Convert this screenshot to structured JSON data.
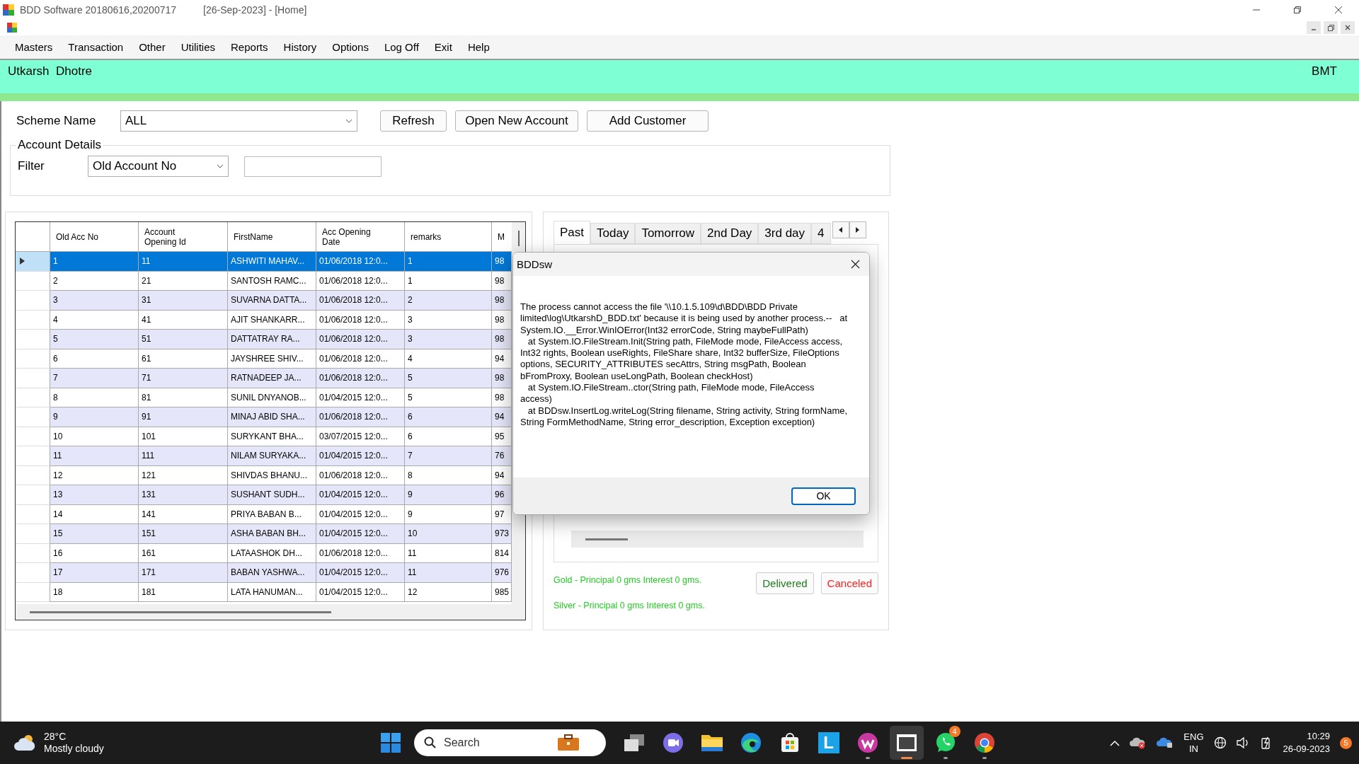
{
  "window": {
    "title": "BDD Software 20180616,20200717",
    "subtitle": "[26-Sep-2023] - [Home]"
  },
  "menu": [
    "Masters",
    "Transaction",
    "Other",
    "Utilities",
    "Reports",
    "History",
    "Options",
    "Log Off",
    "Exit",
    "Help"
  ],
  "header": {
    "user": "Utkarsh  Dhotre",
    "branch": "BMT"
  },
  "scheme": {
    "label": "Scheme Name",
    "value": "ALL"
  },
  "buttons": [
    "Refresh",
    "Open New Account",
    "Add Customer"
  ],
  "account_details": {
    "legend": "Account Details",
    "filter_label": "Filter",
    "filter_value": "Old Account No"
  },
  "table": {
    "columns": [
      "Old Acc No",
      "Account Opening Id",
      "FirstName",
      "Acc Opening Date",
      "remarks",
      "M"
    ],
    "rows": [
      {
        "selected": true,
        "cells": [
          "1",
          "11",
          "ASHWITI MAHAV...",
          "01/06/2018 12:0...",
          "1",
          "98"
        ]
      },
      {
        "selected": false,
        "cells": [
          "2",
          "21",
          "SANTOSH RAMC...",
          "01/06/2018 12:0...",
          "1",
          "98"
        ]
      },
      {
        "selected": false,
        "cells": [
          "3",
          "31",
          "SUVARNA DATTA...",
          "01/06/2018 12:0...",
          "2",
          "98"
        ]
      },
      {
        "selected": false,
        "cells": [
          "4",
          "41",
          "AJIT SHANKARR...",
          "01/06/2018 12:0...",
          "3",
          "98"
        ]
      },
      {
        "selected": false,
        "cells": [
          "5",
          "51",
          "DATTATRAY RA...",
          "01/06/2018 12:0...",
          "3",
          "98"
        ]
      },
      {
        "selected": false,
        "cells": [
          "6",
          "61",
          "JAYSHREE SHIV...",
          "01/06/2018 12:0...",
          "4",
          "94"
        ]
      },
      {
        "selected": false,
        "cells": [
          "7",
          "71",
          "RATNADEEP JA...",
          "01/06/2018 12:0...",
          "5",
          "98"
        ]
      },
      {
        "selected": false,
        "cells": [
          "8",
          "81",
          "SUNIL DNYANOB...",
          "01/04/2015 12:0...",
          "5",
          "98"
        ]
      },
      {
        "selected": false,
        "cells": [
          "9",
          "91",
          "MINAJ ABID SHA...",
          "01/06/2018 12:0...",
          "6",
          "94"
        ]
      },
      {
        "selected": false,
        "cells": [
          "10",
          "101",
          "SURYKANT BHA...",
          "03/07/2015 12:0...",
          "6",
          "95"
        ]
      },
      {
        "selected": false,
        "cells": [
          "11",
          "111",
          "NILAM SURYAKA...",
          "01/04/2015 12:0...",
          "7",
          "76"
        ]
      },
      {
        "selected": false,
        "cells": [
          "12",
          "121",
          "SHIVDAS BHANU...",
          "01/06/2018 12:0...",
          "8",
          "94"
        ]
      },
      {
        "selected": false,
        "cells": [
          "13",
          "131",
          "SUSHANT SUDH...",
          "01/04/2015 12:0...",
          "9",
          "96"
        ]
      },
      {
        "selected": false,
        "cells": [
          "14",
          "141",
          "PRIYA BABAN B...",
          "01/04/2015 12:0...",
          "9",
          "97"
        ]
      },
      {
        "selected": false,
        "cells": [
          "15",
          "151",
          "ASHA BABAN BH...",
          "01/04/2015 12:0...",
          "10",
          "973"
        ]
      },
      {
        "selected": false,
        "cells": [
          "16",
          "161",
          "LATAASHOK DH...",
          "01/06/2018 12:0...",
          "11",
          "814"
        ]
      },
      {
        "selected": false,
        "cells": [
          "17",
          "171",
          "BABAN YASHWA...",
          "01/04/2015 12:0...",
          "11",
          "976"
        ]
      },
      {
        "selected": false,
        "cells": [
          "18",
          "181",
          "LATA HANUMAN...",
          "01/04/2015 12:0...",
          "12",
          "985"
        ]
      }
    ]
  },
  "day_tabs": [
    {
      "label": "Past",
      "selected": true
    },
    {
      "label": "Today",
      "selected": false
    },
    {
      "label": "Tomorrow",
      "selected": false
    },
    {
      "label": "2nd Day",
      "selected": false
    },
    {
      "label": "3rd day",
      "selected": false
    },
    {
      "label": "4",
      "selected": false
    }
  ],
  "summary": [
    "Gold - Principal 0 gms Interest 0 gms.",
    "Silver - Principal 0 gms Interest 0 gms."
  ],
  "status_buttons": [
    {
      "label": "Delivered",
      "color": "#1e7b1e"
    },
    {
      "label": "Canceled",
      "color": "#ff2020"
    }
  ],
  "dialog": {
    "title": "BDDsw",
    "message": "The process cannot access the file '\\\\10.1.5.109\\d\\BDD\\BDD Private limited\\log\\UtkarshD_BDD.txt' because it is being used by another process.--   at System.IO.__Error.WinIOError(Int32 errorCode, String maybeFullPath)\n   at System.IO.FileStream.Init(String path, FileMode mode, FileAccess access, Int32 rights, Boolean useRights, FileShare share, Int32 bufferSize, FileOptions options, SECURITY_ATTRIBUTES secAttrs, String msgPath, Boolean bFromProxy, Boolean useLongPath, Boolean checkHost)\n   at System.IO.FileStream..ctor(String path, FileMode mode, FileAccess access)\n   at BDDsw.InsertLog.writeLog(String filename, String activity, String formName, String FormMethodName, String error_description, Exception exception)",
    "button": "OK"
  },
  "taskbar": {
    "weather": {
      "temp": "28°C",
      "condition": "Mostly cloudy"
    },
    "search": {
      "placeholder": "Search"
    },
    "apps": [
      {
        "kind": "task-view",
        "running": false,
        "active": false
      },
      {
        "kind": "video",
        "running": false,
        "active": false
      },
      {
        "kind": "folder",
        "running": false,
        "active": false
      },
      {
        "kind": "browser-wave",
        "running": false,
        "active": false
      },
      {
        "kind": "store",
        "running": false,
        "active": false
      },
      {
        "kind": "letter",
        "label": "L",
        "running": false,
        "active": false
      },
      {
        "kind": "heart",
        "running": true,
        "active": false
      },
      {
        "kind": "window",
        "running": true,
        "active": true
      },
      {
        "kind": "chat",
        "badge": "4",
        "running": true,
        "active": false
      },
      {
        "kind": "browser-ring",
        "running": true,
        "active": false
      }
    ],
    "tray": {
      "language": "ENG",
      "region": "IN",
      "time": "10:29",
      "date": "26-09-2023",
      "notifications": "5"
    }
  }
}
